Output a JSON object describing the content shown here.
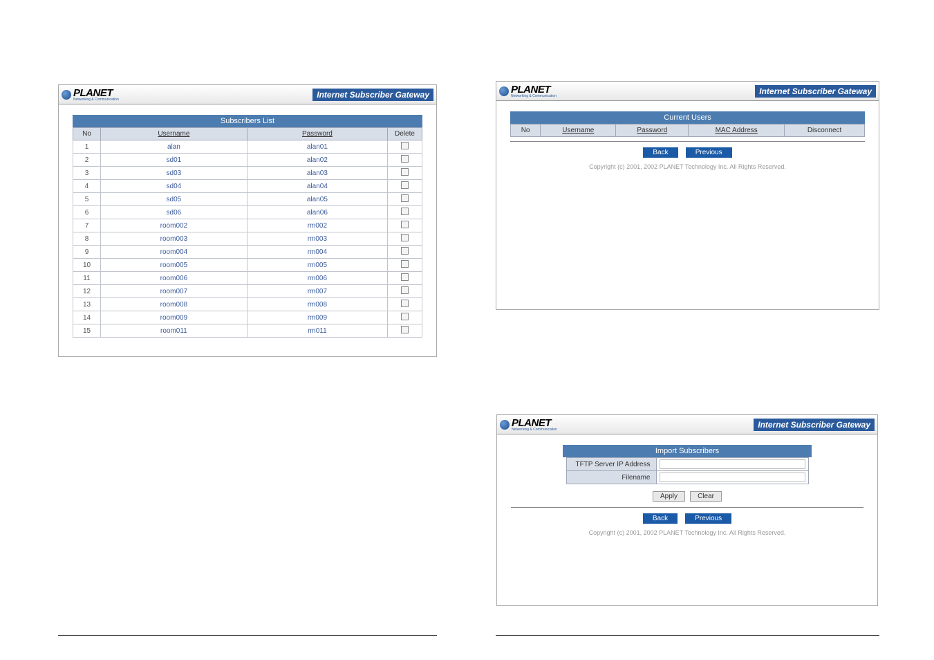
{
  "brand": {
    "name": "PLANET",
    "tagline": "Networking & Communication",
    "product": "Internet Subscriber Gateway"
  },
  "panel1": {
    "title": "Subscribers List",
    "columns": {
      "no": "No",
      "username": "Username",
      "password": "Password",
      "delete": "Delete"
    },
    "rows": [
      {
        "no": "1",
        "username": "alan",
        "password": "alan01"
      },
      {
        "no": "2",
        "username": "sd01",
        "password": "alan02"
      },
      {
        "no": "3",
        "username": "sd03",
        "password": "alan03"
      },
      {
        "no": "4",
        "username": "sd04",
        "password": "alan04"
      },
      {
        "no": "5",
        "username": "sd05",
        "password": "alan05"
      },
      {
        "no": "6",
        "username": "sd06",
        "password": "alan06"
      },
      {
        "no": "7",
        "username": "room002",
        "password": "rm002"
      },
      {
        "no": "8",
        "username": "room003",
        "password": "rm003"
      },
      {
        "no": "9",
        "username": "room004",
        "password": "rm004"
      },
      {
        "no": "10",
        "username": "room005",
        "password": "rm005"
      },
      {
        "no": "11",
        "username": "room006",
        "password": "rm006"
      },
      {
        "no": "12",
        "username": "room007",
        "password": "rm007"
      },
      {
        "no": "13",
        "username": "room008",
        "password": "rm008"
      },
      {
        "no": "14",
        "username": "room009",
        "password": "rm009"
      },
      {
        "no": "15",
        "username": "room011",
        "password": "rm011"
      }
    ]
  },
  "panel2": {
    "title": "Current Users",
    "columns": {
      "no": "No",
      "username": "Username",
      "password": "Password",
      "mac": "MAC Address",
      "disconnect": "Disconnect"
    },
    "buttons": {
      "back": "Back",
      "previous": "Previous"
    },
    "copyright": "Copyright (c) 2001, 2002 PLANET Technology Inc. All Rights Reserved."
  },
  "panel3": {
    "title": "Import Subscribers",
    "fields": {
      "tftp": "TFTP Server IP Address",
      "filename": "Filename"
    },
    "buttons": {
      "apply": "Apply",
      "clear": "Clear",
      "back": "Back",
      "previous": "Previous"
    },
    "copyright": "Copyright (c) 2001, 2002 PLANET Technology Inc. All Rights Reserved."
  }
}
